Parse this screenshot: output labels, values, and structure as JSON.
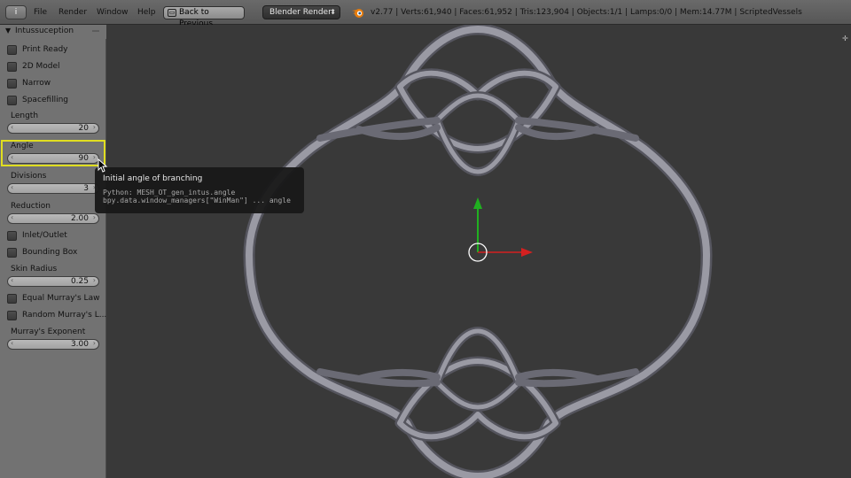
{
  "header": {
    "editor_icon": "i",
    "menus": [
      "File",
      "Render",
      "Window",
      "Help"
    ],
    "back_button": "Back to Previous",
    "render_engine": "Blender Render",
    "stats": "v2.77 | Verts:61,940 | Faces:61,952 | Tris:123,904 | Objects:1/1 | Lamps:0/0 | Mem:14.77M | ScriptedVessels"
  },
  "toolshelf": {
    "panel_title": "Intussuception",
    "checkboxes": {
      "print_ready": "Print Ready",
      "model_2d": "2D Model",
      "narrow": "Narrow",
      "spacefilling": "Spacefilling",
      "inlet_outlet": "Inlet/Outlet",
      "bounding_box": "Bounding Box",
      "equal_murray": "Equal Murray's Law",
      "random_murray": "Random Murray's L..."
    },
    "fields": {
      "length": {
        "label": "Length",
        "value": "20"
      },
      "angle": {
        "label": "Angle",
        "value": "90"
      },
      "divisions": {
        "label": "Divisions",
        "value": "3"
      },
      "reduction": {
        "label": "Reduction",
        "value": "2.00"
      },
      "skin_radius": {
        "label": "Skin Radius",
        "value": "0.25"
      },
      "murray_exponent": {
        "label": "Murray's Exponent",
        "value": "3.00"
      }
    }
  },
  "tooltip": {
    "title": "Initial angle of branching",
    "python": "Python: MESH_OT_gen_intus.angle",
    "path": "bpy.data.window_managers[\"WinMan\"] ... angle"
  },
  "colors": {
    "highlight": "#e0de20",
    "axis_x": "#d42020",
    "axis_y": "#20b020",
    "vessel": "#8c8c96"
  },
  "icons": [
    "info-icon",
    "back-screen-icon",
    "dropdown-arrows-icon",
    "blender-logo-icon",
    "collapse-triangle-icon",
    "grip-icon",
    "arrow-left-icon",
    "arrow-right-icon",
    "plus-icon",
    "mouse-cursor-icon"
  ]
}
